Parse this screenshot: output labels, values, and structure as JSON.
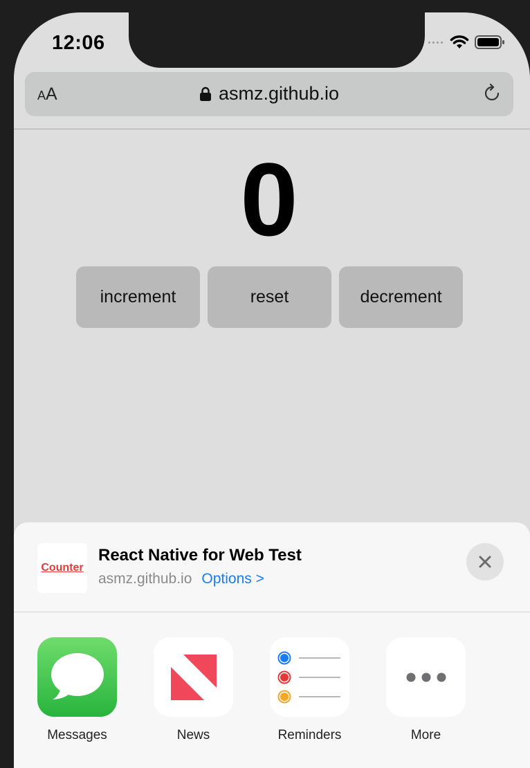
{
  "status_bar": {
    "time": "12:06"
  },
  "browser": {
    "text_size_small": "A",
    "text_size_big": "A",
    "url": "asmz.github.io"
  },
  "counter": {
    "value": "0",
    "buttons": {
      "increment": "increment",
      "reset": "reset",
      "decrement": "decrement"
    }
  },
  "share_sheet": {
    "thumbnail_text": "Counter",
    "title": "React Native for Web Test",
    "domain": "asmz.github.io",
    "options_label": "Options >",
    "apps": [
      {
        "label": "Messages",
        "icon": "messages-icon"
      },
      {
        "label": "News",
        "icon": "news-icon"
      },
      {
        "label": "Reminders",
        "icon": "reminders-icon"
      },
      {
        "label": "More",
        "icon": "more-icon"
      }
    ]
  },
  "colors": {
    "accent": "#1a7cf5",
    "messages_green": "#34c759",
    "news_red": "#f0485a",
    "reminder_blue": "#1a7cf5",
    "reminder_red": "#e53935",
    "reminder_orange": "#f5a623"
  }
}
